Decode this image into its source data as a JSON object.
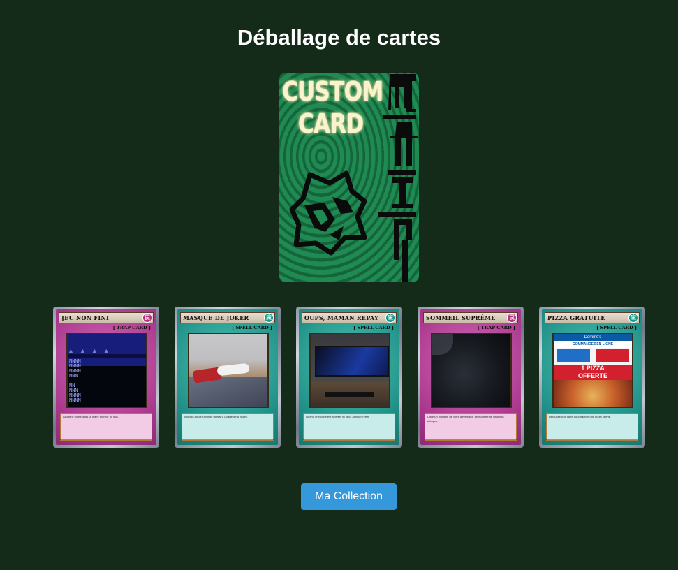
{
  "page": {
    "title": "Déballage de cartes"
  },
  "pack": {
    "text_line1": "CUSTOM",
    "text_line2": "CARD",
    "logo_icon": "wolf-head-icon",
    "colors": {
      "background": "#1f8a52",
      "text": "#fbf3cf"
    }
  },
  "cards": [
    {
      "name": "JEU NON FINI",
      "type_label": "[ TRAP CARD ]",
      "kind": "trap",
      "art": "pixel-game-screenshot",
      "description": "Ajoute le boléa dans ta main/ archive un truc."
    },
    {
      "name": "MASQUE DE JOKER",
      "type_label": "[ SPELL CARD ]",
      "kind": "spell",
      "art": "joker-mask-photo",
      "description": "Appose-toi de l'actif de ta main/ 1 carte de ta main/."
    },
    {
      "name": "OUPS, MAMAN REPAY",
      "type_label": "[ SPELL CARD ]",
      "kind": "spell",
      "art": "computer-desk-photo",
      "description": "Quand une carte est activée, tu peux annuler l'effet."
    },
    {
      "name": "SOMMEIL SUPRÊME",
      "type_label": "[ TRAP CARD ]",
      "kind": "trap",
      "art": "dark-sleep-photo",
      "description": "Cible un monstre de votre adversaire, ce monstre ne peut pas attaquer."
    },
    {
      "name": "PIZZA GRATUITE",
      "type_label": "[ SPELL CARD ]",
      "kind": "spell",
      "art": "dominos-pizza-ad",
      "description": "Défausse une carte pour gagner une pizza offerte."
    }
  ],
  "pizza_ad": {
    "brand": "Domino's",
    "banner": "COMMANDEZ EN LIGNE",
    "offer_line1": "1 PIZZA",
    "offer_line2": "OFFERTE"
  },
  "button": {
    "label": "Ma Collection",
    "color": "#3498db"
  },
  "colors": {
    "page_bg": "#142b1a",
    "trap": "#a8378c",
    "spell": "#1e8e84"
  }
}
